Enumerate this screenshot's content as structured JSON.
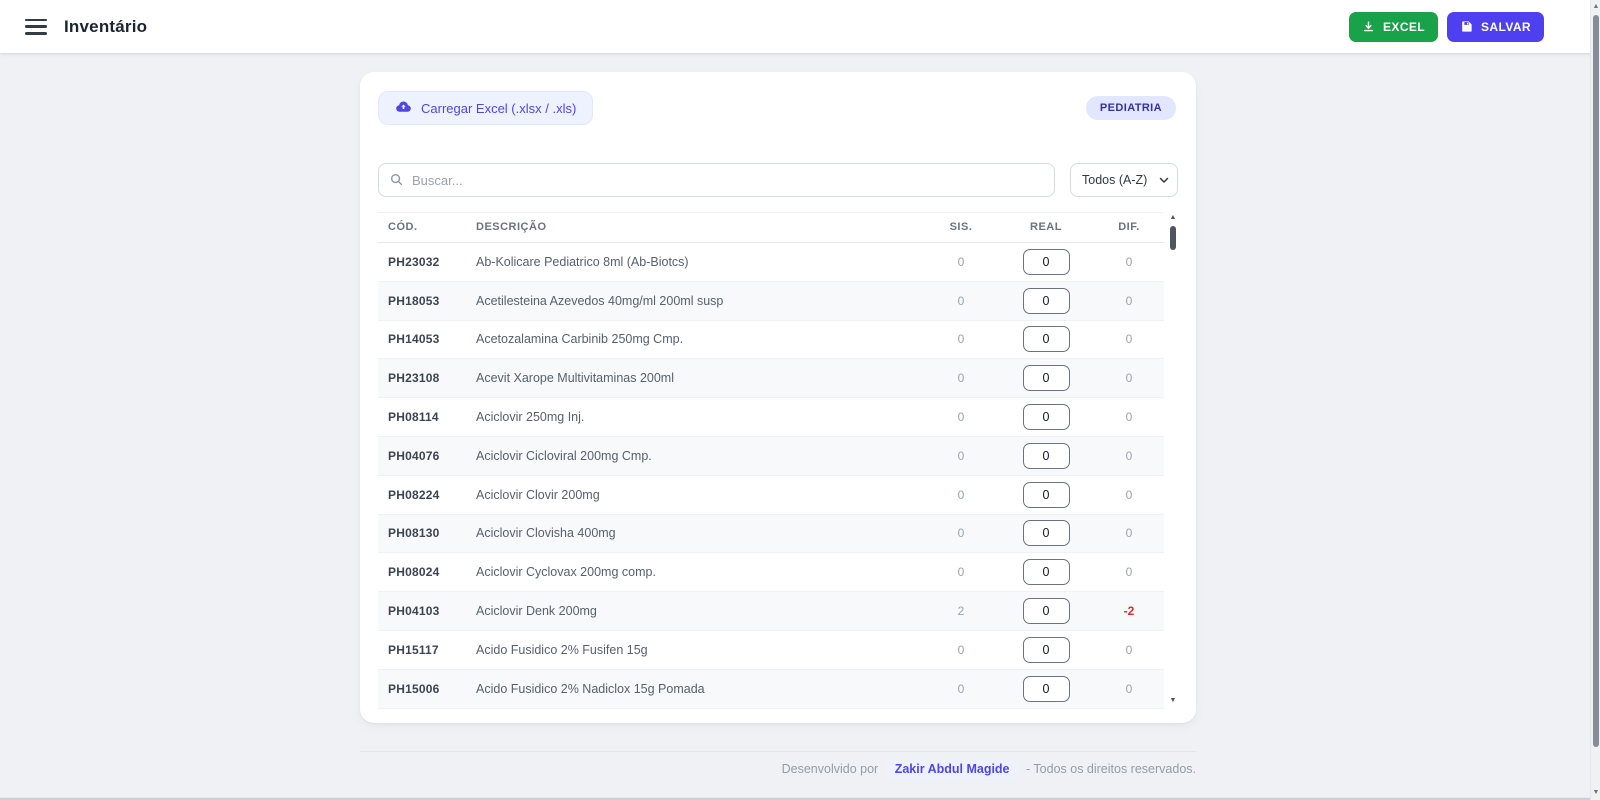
{
  "header": {
    "title": "Inventário",
    "excel_button": "EXCEL",
    "save_button": "SALVAR"
  },
  "toolbar": {
    "upload_label": "Carregar Excel (.xlsx / .xls)",
    "category_badge": "PEDIATRIA",
    "search_placeholder": "Buscar...",
    "sort_selected": "Todos (A-Z)"
  },
  "table": {
    "columns": [
      "CÓD.",
      "DESCRIÇÃO",
      "SIS.",
      "REAL",
      "DIF."
    ],
    "rows": [
      {
        "code": "PH23032",
        "description": "Ab-Kolicare Pediatrico 8ml (Ab-Biotcs)",
        "sis": "0",
        "real": "0",
        "dif": "0"
      },
      {
        "code": "PH18053",
        "description": "Acetilesteina Azevedos 40mg/ml 200ml susp",
        "sis": "0",
        "real": "0",
        "dif": "0"
      },
      {
        "code": "PH14053",
        "description": "Acetozalamina Carbinib 250mg Cmp.",
        "sis": "0",
        "real": "0",
        "dif": "0"
      },
      {
        "code": "PH23108",
        "description": "Acevit Xarope Multivitaminas 200ml",
        "sis": "0",
        "real": "0",
        "dif": "0"
      },
      {
        "code": "PH08114",
        "description": "Aciclovir 250mg Inj.",
        "sis": "0",
        "real": "0",
        "dif": "0"
      },
      {
        "code": "PH04076",
        "description": "Aciclovir Cicloviral 200mg Cmp.",
        "sis": "0",
        "real": "0",
        "dif": "0"
      },
      {
        "code": "PH08224",
        "description": "Aciclovir Clovir 200mg",
        "sis": "0",
        "real": "0",
        "dif": "0"
      },
      {
        "code": "PH08130",
        "description": "Aciclovir Clovisha 400mg",
        "sis": "0",
        "real": "0",
        "dif": "0"
      },
      {
        "code": "PH08024",
        "description": "Aciclovir Cyclovax 200mg comp.",
        "sis": "0",
        "real": "0",
        "dif": "0"
      },
      {
        "code": "PH04103",
        "description": "Aciclovir Denk 200mg",
        "sis": "2",
        "real": "0",
        "dif": "-2"
      },
      {
        "code": "PH15117",
        "description": "Acido Fusidico 2% Fusifen 15g",
        "sis": "0",
        "real": "0",
        "dif": "0"
      },
      {
        "code": "PH15006",
        "description": "Acido Fusidico 2% Nadiclox 15g Pomada",
        "sis": "0",
        "real": "0",
        "dif": "0"
      }
    ]
  },
  "footer": {
    "prefix": "Desenvolvido por",
    "author": "Zakir Abdul Magide",
    "suffix": "- Todos os direitos reservados."
  },
  "colors": {
    "excel_green": "#18a24a",
    "save_indigo": "#4e3ff0",
    "accent_indigo": "#4f46e5",
    "accent_indigo_dark": "#3730a3",
    "negative_red": "#d92b2b"
  }
}
